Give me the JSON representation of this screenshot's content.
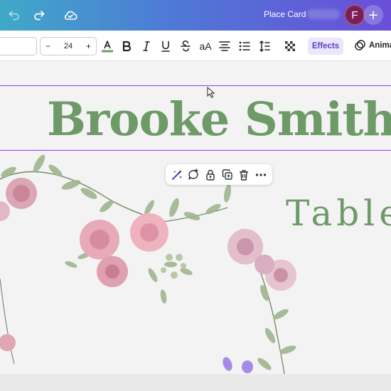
{
  "header": {
    "doc_title": "Place Card",
    "avatar_initial": "F",
    "add_label": "+"
  },
  "toolbar": {
    "font_size_decrease": "−",
    "font_size": "24",
    "font_size_increase": "+",
    "text_case_label": "aA",
    "effects_label": "Effects",
    "animate_label": "Anima"
  },
  "canvas": {
    "name": "Brooke Smith",
    "table": "Table"
  },
  "colors": {
    "accent": "#8b3dff",
    "text_green": "#6e9a68",
    "header_start": "#3fa9c8",
    "header_end": "#6a4ed8"
  }
}
